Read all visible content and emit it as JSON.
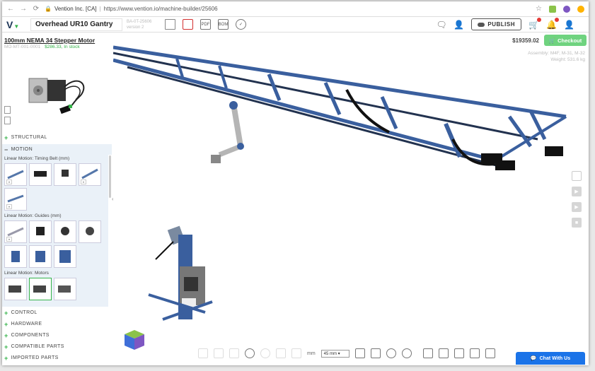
{
  "browser": {
    "site": "Vention Inc. [CA]",
    "url": "https://www.vention.io/machine-builder/25606"
  },
  "header": {
    "project_title": "Overhead UR10 Gantry",
    "project_id": "BA-0T-25606",
    "version": "version 2",
    "publish_label": "PUBLISH"
  },
  "sidebar": {
    "product_name": "100mm NEMA 34 Stepper Motor",
    "product_ref": "MO-MT-001-0001",
    "product_stock": "$286.33, In stock",
    "categories_top": [
      {
        "label": "STRUCTURAL",
        "expanded": false
      },
      {
        "label": "MOTION",
        "expanded": true
      }
    ],
    "sections": [
      {
        "title": "Linear Motion: Timing Belt (mm)"
      },
      {
        "title": "Linear Motion: Guides (mm)"
      },
      {
        "title": "Linear Motion: Motors"
      }
    ],
    "categories_bottom": [
      {
        "label": "CONTROL"
      },
      {
        "label": "HARDWARE"
      },
      {
        "label": "COMPONENTS"
      },
      {
        "label": "COMPATIBLE PARTS"
      },
      {
        "label": "IMPORTED PARTS"
      }
    ]
  },
  "viewport": {
    "price": "$19359.02",
    "checkout_label": "Checkout",
    "assembly_line1": "Assembly: M4F, M-31, M-32",
    "assembly_line2": "Weight: 531.6 kg",
    "units_label": "mm",
    "unit_select": "45 mm",
    "chat_label": "Chat With Us"
  },
  "colors": {
    "accent_green": "#35b34a",
    "frame_blue": "#3a5f9e",
    "chat_blue": "#1a73e8"
  }
}
